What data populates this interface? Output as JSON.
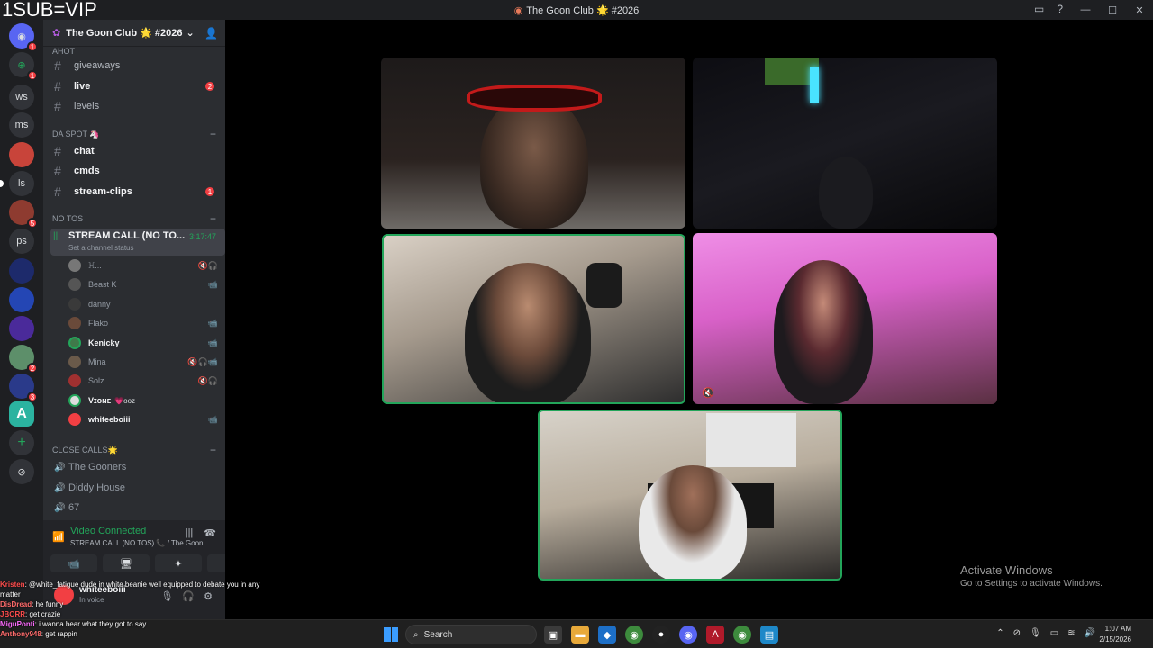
{
  "overlay_text": "1SUB=VIP",
  "window": {
    "title": "The Goon Club 🌟 #2026",
    "minimize": "—",
    "maximize": "☐",
    "close": "✕"
  },
  "guilds": [
    {
      "label": "",
      "badge": "1"
    },
    {
      "label": "",
      "badge": "1"
    },
    {
      "label": "ws",
      "badge": ""
    },
    {
      "label": "ms",
      "badge": ""
    },
    {
      "label": "",
      "badge": ""
    },
    {
      "label": "ls",
      "badge": ""
    },
    {
      "label": "",
      "badge": "5"
    },
    {
      "label": "ps",
      "badge": ""
    },
    {
      "label": "",
      "badge": ""
    },
    {
      "label": "",
      "badge": ""
    },
    {
      "label": "",
      "badge": ""
    },
    {
      "label": "",
      "badge": "2"
    },
    {
      "label": "",
      "badge": "3"
    },
    {
      "label": "A",
      "badge": ""
    },
    {
      "label": "+",
      "badge": ""
    },
    {
      "label": "⊘",
      "badge": ""
    }
  ],
  "server": {
    "name": "The Goon Club 🌟 #2026",
    "categories": {
      "top_partial": "AHOT",
      "da_spot": "DA SPOT 🦄",
      "no_tos": "NO TOS",
      "close_calls": "CLOSE CALLS🌟"
    },
    "channels_top": [
      {
        "name": "giveaways",
        "badge": ""
      },
      {
        "name": "live",
        "badge": "2"
      },
      {
        "name": "levels",
        "badge": ""
      }
    ],
    "channels_da_spot": [
      {
        "name": "chat",
        "badge": ""
      },
      {
        "name": "cmds",
        "badge": ""
      },
      {
        "name": "stream-clips",
        "badge": "1"
      }
    ],
    "voice": {
      "name": "STREAM CALL (NO TO...",
      "time": "3:17:47",
      "status": "Set a channel status"
    },
    "members": [
      {
        "name": "ꖾ...",
        "strong": false,
        "icons": "🔇🎧"
      },
      {
        "name": "Beast K",
        "strong": false,
        "icons": "📹"
      },
      {
        "name": "danny",
        "strong": false,
        "icons": ""
      },
      {
        "name": "Flako",
        "strong": false,
        "icons": "📹"
      },
      {
        "name": "Kenicky",
        "strong": true,
        "icons": "📹"
      },
      {
        "name": "Mina",
        "strong": false,
        "icons": "🔇🎧📹"
      },
      {
        "name": "Solz",
        "strong": false,
        "icons": "🔇🎧"
      },
      {
        "name": "Vɪᴏɴᴇ",
        "suffix": "💗ooz",
        "strong": true,
        "icons": ""
      },
      {
        "name": "whiteeboiii",
        "strong": true,
        "icons": "📹"
      }
    ],
    "voice_close_calls": [
      {
        "name": "The Gooners"
      },
      {
        "name": "Diddy House"
      },
      {
        "name": "67"
      }
    ]
  },
  "panel": {
    "connected": "Video Connected",
    "subtitle": "STREAM CALL (NO TOS) 📞 / The Goon...",
    "buttons": [
      "📹",
      "🖥",
      "✦",
      "✺"
    ],
    "user": {
      "name": "whiteeboiii",
      "status": "In voice"
    }
  },
  "chat_overlay": [
    {
      "user": "Kristen",
      "color": "#ff4d4d",
      "text": ": @white_fatigue dude in white beanie well equipped to debate you in any"
    },
    {
      "user": "",
      "color": "#ff4d4d",
      "text": "matter"
    },
    {
      "user": "DisDread",
      "color": "#ff6b6b",
      "text": ": he funny"
    },
    {
      "user": "JBORR",
      "color": "#ff4d4d",
      "text": ": get crazie"
    },
    {
      "user": "MiguPonti",
      "color": "#ff6bff",
      "text": ": i wanna hear what they got to say"
    },
    {
      "user": "Anthony948",
      "color": "#ff6b6b",
      "text": ": get rappin"
    }
  ],
  "activate": {
    "title": "Activate Windows",
    "sub": "Go to Settings to activate Windows."
  },
  "taskbar": {
    "search_placeholder": "Search",
    "time": "1:07 AM",
    "date": "2/15/2026"
  },
  "colors": {
    "accent_green": "#23a55a",
    "badge_red": "#f23f43",
    "sidebar": "#2b2d31",
    "guild_bar": "#1e1f22"
  }
}
